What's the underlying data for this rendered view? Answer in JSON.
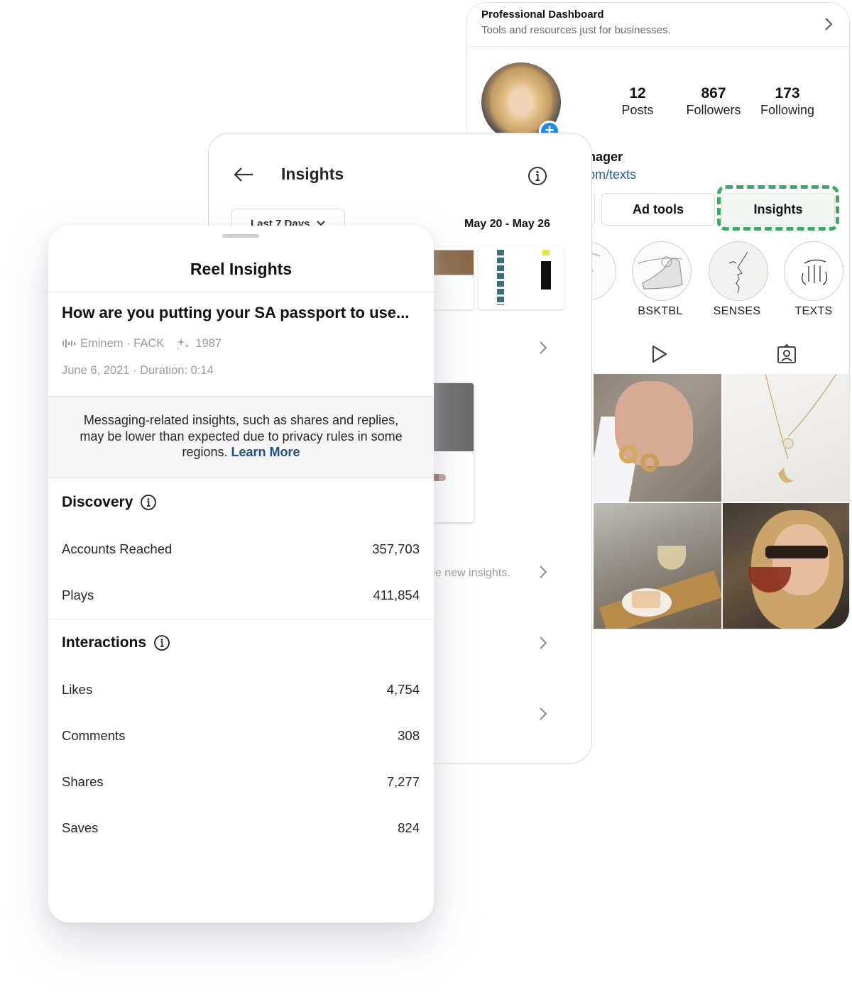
{
  "profile": {
    "dashboard_title": "Professional Dashboard",
    "dashboard_subtitle": "Tools and resources just for businesses.",
    "stats": [
      {
        "value": "12",
        "label": "Posts"
      },
      {
        "value": "867",
        "label": "Followers"
      },
      {
        "value": "173",
        "label": "Following"
      }
    ],
    "bio_name_partial": "nager",
    "bio_link_partial": "om/texts",
    "buttons": {
      "ad_tools": "Ad tools",
      "insights": "Insights"
    },
    "highlight_color": "#3daa63",
    "highlights": [
      {
        "label": ""
      },
      {
        "label": "BSKTBL"
      },
      {
        "label": "SENSES"
      },
      {
        "label": "TEXTS"
      }
    ],
    "tabs": [
      "reels-tab",
      "tagged-tab"
    ]
  },
  "insights": {
    "title": "Insights",
    "range_label": "Last 7 Days",
    "date_range": "May 20 - May 26",
    "partial_text": "ee new insights."
  },
  "reel": {
    "title": "Reel Insights",
    "post_title": "How are you putting your SA passport to use...",
    "audio": "Eminem · FACK",
    "effect": "1987",
    "date_duration": "June 6, 2021 · Duration: 0:14",
    "notice_text": "Messaging-related insights, such as shares and replies, may be lower than expected due to privacy rules in some regions.",
    "notice_link": "Learn More",
    "link_color": "#1e4f8c",
    "discovery": {
      "heading": "Discovery",
      "rows": [
        {
          "label": "Accounts Reached",
          "value": "357,703"
        },
        {
          "label": "Plays",
          "value": "411,854"
        }
      ]
    },
    "interactions": {
      "heading": "Interactions",
      "rows": [
        {
          "label": "Likes",
          "value": "4,754"
        },
        {
          "label": "Comments",
          "value": "308"
        },
        {
          "label": "Shares",
          "value": "7,277"
        },
        {
          "label": "Saves",
          "value": "824"
        }
      ]
    }
  }
}
